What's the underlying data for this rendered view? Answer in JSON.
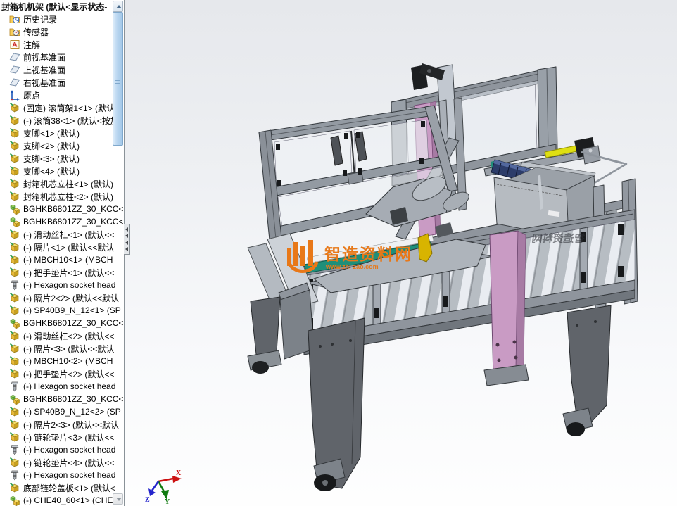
{
  "feature_tree": {
    "title": "封箱机机架  (默认<显示状态-",
    "items": [
      {
        "icon": "history-folder",
        "label": "历史记录"
      },
      {
        "icon": "sensor-folder",
        "label": "传感器"
      },
      {
        "icon": "annotations-folder",
        "label": "注解"
      },
      {
        "icon": "plane",
        "label": "前视基准面"
      },
      {
        "icon": "plane",
        "label": "上视基准面"
      },
      {
        "icon": "plane",
        "label": "右视基准面"
      },
      {
        "icon": "origin",
        "label": "原点"
      },
      {
        "icon": "part",
        "label": "(固定) 滚筒架1<1> (默认-"
      },
      {
        "icon": "part",
        "label": "(-) 滚筒38<1> (默认<按加"
      },
      {
        "icon": "part",
        "label": "支脚<1> (默认)"
      },
      {
        "icon": "part",
        "label": "支脚<2> (默认)"
      },
      {
        "icon": "part",
        "label": "支脚<3> (默认)"
      },
      {
        "icon": "part",
        "label": "支脚<4> (默认)"
      },
      {
        "icon": "part",
        "label": "封箱机芯立柱<1> (默认)"
      },
      {
        "icon": "part",
        "label": "封箱机芯立柱<2> (默认)"
      },
      {
        "icon": "assembly",
        "label": "BGHKB6801ZZ_30_KCC<"
      },
      {
        "icon": "assembly",
        "label": "BGHKB6801ZZ_30_KCC<"
      },
      {
        "icon": "part",
        "label": "(-) 滑动丝杠<1> (默认<<"
      },
      {
        "icon": "part",
        "label": "(-) 隔片<1> (默认<<默认"
      },
      {
        "icon": "part",
        "label": "(-) MBCH10<1> (MBCH"
      },
      {
        "icon": "part",
        "label": "(-) 把手垫片<1> (默认<<"
      },
      {
        "icon": "screw",
        "label": "(-) Hexagon socket head"
      },
      {
        "icon": "part",
        "label": "(-) 隔片2<2> (默认<<默认"
      },
      {
        "icon": "part",
        "label": "(-) SP40B9_N_12<1> (SP"
      },
      {
        "icon": "assembly",
        "label": "BGHKB6801ZZ_30_KCC<"
      },
      {
        "icon": "part",
        "label": "(-) 滑动丝杠<2> (默认<<"
      },
      {
        "icon": "part",
        "label": "(-) 隔片<3> (默认<<默认"
      },
      {
        "icon": "part",
        "label": "(-) MBCH10<2> (MBCH"
      },
      {
        "icon": "part",
        "label": "(-) 把手垫片<2> (默认<<"
      },
      {
        "icon": "screw",
        "label": "(-) Hexagon socket head"
      },
      {
        "icon": "assembly",
        "label": "BGHKB6801ZZ_30_KCC<"
      },
      {
        "icon": "part",
        "label": "(-) SP40B9_N_12<2> (SP"
      },
      {
        "icon": "part",
        "label": "(-) 隔片2<3> (默认<<默认"
      },
      {
        "icon": "part",
        "label": "(-) 链轮垫片<3> (默认<<"
      },
      {
        "icon": "screw",
        "label": "(-) Hexagon socket head"
      },
      {
        "icon": "part",
        "label": "(-) 链轮垫片<4> (默认<<"
      },
      {
        "icon": "screw",
        "label": "(-) Hexagon socket head"
      },
      {
        "icon": "part",
        "label": "底部链轮盖板<1> (默认<"
      },
      {
        "icon": "assembly",
        "label": "(-) CHE40_60<1> (CHE4"
      }
    ]
  },
  "icon_glyphs": {
    "annotation": "A"
  },
  "watermark": {
    "text": "智造资料网",
    "subtext": "www.zhi-zao.com",
    "color": "#e87818"
  },
  "glass_watermark": {
    "text": "智造资料网"
  },
  "triad": {
    "x_label": "X",
    "y_label": "Y",
    "z_label": "Z",
    "x_color": "#cc1111",
    "y_color": "#0f7a0f",
    "z_color": "#2424cc"
  },
  "colors": {
    "aluminum": "#9aa0a8",
    "aluminum_dark": "#8f959d",
    "leg_gray": "#60646a",
    "pink": "#c99bc4",
    "pink_side": "#a77ba4",
    "yellow_rod": "#dfdf12",
    "tape_roll_blue": "#2c3c6a",
    "teal": "#1f8f7a",
    "glass": "#e9edf2",
    "scrollbar_thumb": "#b8d5ef"
  }
}
